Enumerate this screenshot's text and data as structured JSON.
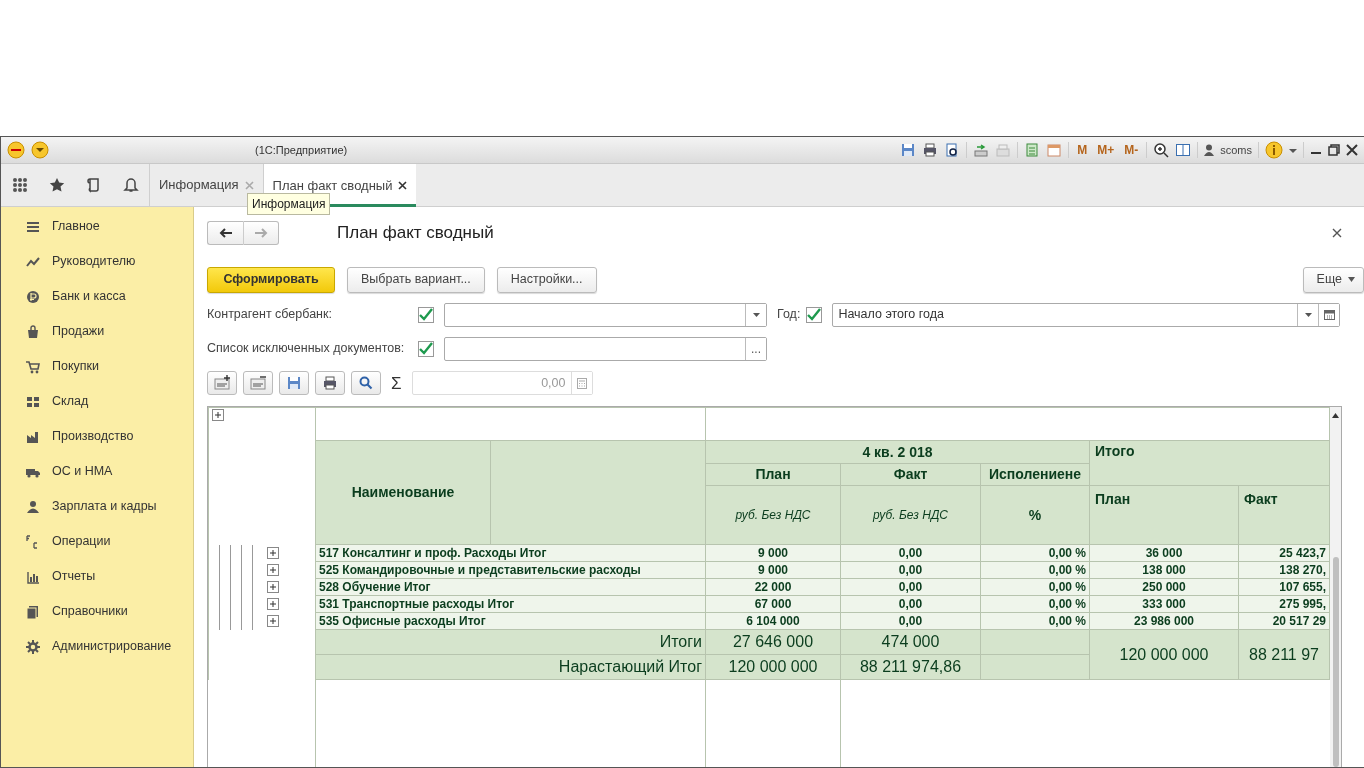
{
  "window": {
    "title": "(1С:Предприятие)",
    "memory_buttons": [
      "M",
      "M+",
      "M-"
    ],
    "user": "scoms"
  },
  "tabs": [
    {
      "label": "Информация",
      "selected": false
    },
    {
      "label": "План факт сводный",
      "selected": true
    }
  ],
  "tooltip": "Информация",
  "sidebar": {
    "items": [
      {
        "label": "Главное"
      },
      {
        "label": "Руководителю"
      },
      {
        "label": "Банк и касса"
      },
      {
        "label": "Продажи"
      },
      {
        "label": "Покупки"
      },
      {
        "label": "Склад"
      },
      {
        "label": "Производство"
      },
      {
        "label": "ОС и НМА"
      },
      {
        "label": "Зарплата и кадры"
      },
      {
        "label": "Операции"
      },
      {
        "label": "Отчеты"
      },
      {
        "label": "Справочники"
      },
      {
        "label": "Администрирование"
      }
    ]
  },
  "form": {
    "title": "План факт сводный",
    "buttons": [
      {
        "label": "Сформировать",
        "kind": "primary"
      },
      {
        "label": "Выбрать вариант...",
        "kind": "default"
      },
      {
        "label": "Настройки...",
        "kind": "default"
      }
    ],
    "more_button": "Еще",
    "filters": [
      {
        "label": "Контрагент сбербанк:",
        "checked": true,
        "kind": "dropdown"
      },
      {
        "label": "Год:",
        "checked": true,
        "kind": "date",
        "value": "Начало этого года"
      },
      {
        "label": "Список исключенных документов:",
        "checked": true,
        "kind": "list",
        "select_button": "..."
      }
    ],
    "sum_sign": "Σ",
    "sum_value": "0,00"
  },
  "report": {
    "name_header": "Наименование",
    "period": "4 кв. 2 018",
    "total_header": "Итого",
    "columns": [
      "План",
      "Факт",
      "Исполениене"
    ],
    "units": [
      "руб. Без НДС",
      "руб. Без НДС",
      "%"
    ],
    "total_columns": [
      "План",
      "Факт"
    ],
    "rows": [
      {
        "name": "517 Консалтинг и проф. Расходы Итог",
        "expanded": false,
        "plan": "9 000",
        "fact": "0,00",
        "percent": "0,00 %",
        "total_plan": "36 000",
        "total_fact": "25 423,7"
      },
      {
        "name": "525 Командировочные и представительские расходы",
        "expanded": false,
        "plan": "9 000",
        "fact": "0,00",
        "percent": "0,00 %",
        "total_plan": "138 000",
        "total_fact": "138 270,"
      },
      {
        "name": "528 Обучение Итог",
        "expanded": false,
        "plan": "22 000",
        "fact": "0,00",
        "percent": "0,00 %",
        "total_plan": "250 000",
        "total_fact": "107 655,"
      },
      {
        "name": "531 Транспортные расходы Итог",
        "expanded": false,
        "plan": "67 000",
        "fact": "0,00",
        "percent": "0,00 %",
        "total_plan": "333 000",
        "total_fact": "275 995,"
      },
      {
        "name": "535 Офисные расходы Итог",
        "expanded": false,
        "plan": "6 104 000",
        "fact": "0,00",
        "percent": "0,00 %",
        "total_plan": "23 986 000",
        "total_fact": "20 517 29"
      }
    ],
    "totals": [
      {
        "label": "Итоги",
        "plan": "27 646 000",
        "fact": "474 000"
      },
      {
        "label": "Нарастающий Итог",
        "plan": "120 000 000",
        "fact": "88 211 974,86"
      }
    ],
    "grand_total": {
      "plan": "120 000 000",
      "fact": "88 211 97"
    }
  }
}
